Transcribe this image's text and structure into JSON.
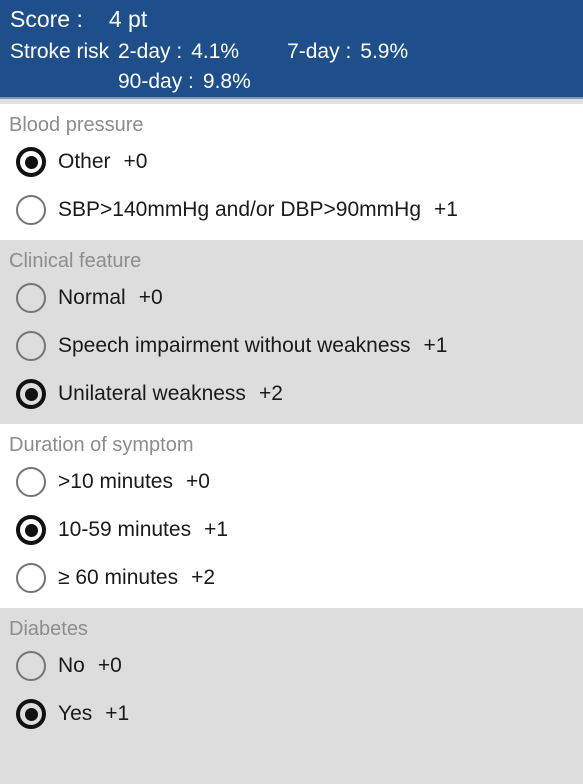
{
  "header": {
    "score_label": "Score :",
    "score_value": "4 pt",
    "risk_title": "Stroke risk",
    "risks": [
      {
        "label": "2-day :",
        "value": "4.1%"
      },
      {
        "label": "7-day :",
        "value": "5.9%"
      },
      {
        "label": "90-day :",
        "value": "9.8%"
      }
    ],
    "background_color": "#1e4f8a",
    "text_color": "#ffffff"
  },
  "sections": [
    {
      "title": "Blood pressure",
      "background": "light",
      "options": [
        {
          "label": "Other",
          "points": "+0",
          "selected": true
        },
        {
          "label": "SBP>140mmHg and/or DBP>90mmHg",
          "points": "+1",
          "selected": false
        }
      ]
    },
    {
      "title": "Clinical feature",
      "background": "shade",
      "options": [
        {
          "label": "Normal",
          "points": "+0",
          "selected": false
        },
        {
          "label": "Speech impairment without weakness",
          "points": "+1",
          "selected": false
        },
        {
          "label": "Unilateral weakness",
          "points": "+2",
          "selected": true
        }
      ]
    },
    {
      "title": "Duration of symptom",
      "background": "light",
      "options": [
        {
          "label": ">10 minutes",
          "points": "+0",
          "selected": false
        },
        {
          "label": "10-59 minutes",
          "points": "+1",
          "selected": true
        },
        {
          "label": "≥ 60 minutes",
          "points": "+2",
          "selected": false
        }
      ]
    },
    {
      "title": "Diabetes",
      "background": "shade",
      "options": [
        {
          "label": "No",
          "points": "+0",
          "selected": false
        },
        {
          "label": "Yes",
          "points": "+1",
          "selected": true
        }
      ]
    }
  ],
  "colors": {
    "header_blue": "#1e4f8a",
    "header_rule": "#7e95bd",
    "section_shade": "#dddddd",
    "section_light": "#ffffff",
    "section_title": "#8d8d8d",
    "radio_selected": "#111111",
    "radio_unselected": "#757575"
  }
}
